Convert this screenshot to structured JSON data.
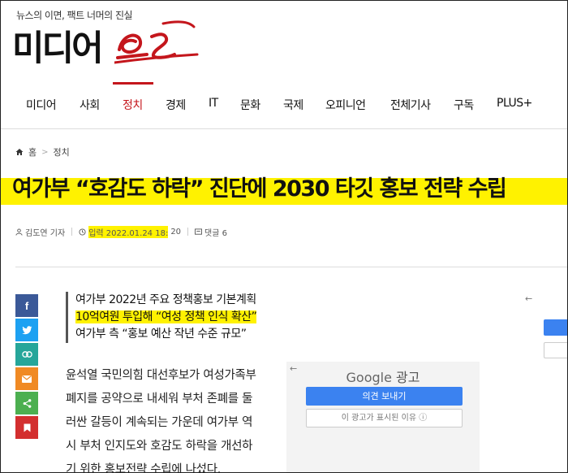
{
  "header": {
    "tagline": "뉴스의 이면, 팩트 너머의 진실",
    "logo_text": "미디어",
    "logo_script": "오늘"
  },
  "nav": {
    "items": [
      {
        "label": "미디어"
      },
      {
        "label": "사회"
      },
      {
        "label": "정치"
      },
      {
        "label": "경제"
      },
      {
        "label": "IT"
      },
      {
        "label": "문화"
      },
      {
        "label": "국제"
      },
      {
        "label": "오피니언"
      },
      {
        "label": "전체기사"
      },
      {
        "label": "구독"
      },
      {
        "label": "PLUS+"
      }
    ],
    "active": "정치",
    "accent_color": "#c4161c"
  },
  "breadcrumb": {
    "home": "홈",
    "section": "정치"
  },
  "article": {
    "headline": "여가부 “호감도 하락” 진단에 2030 타깃 홍보 전략 수립",
    "author": "김도연 기자",
    "date_label": "입력",
    "date": "2022.01.24 18:",
    "date_min": "20",
    "comments": "댓글 6",
    "subtitles": [
      "여가부 2022년 주요 정책홍보 기본계획",
      "10억여원 투입해 “여성 정책 인식 확산”",
      "여가부 측 “홍보 예산 작년 수준 규모”"
    ],
    "body_lines": [
      "윤석열 국민의힘 대선후보가 여성가족부",
      "폐지를 공약으로 내세워 부처 존폐를 둘",
      "러싼 갈등이 계속되는 가운데 여가부 역",
      "시 부처 인지도와 호감도 하락을 개선하",
      "기 위한 홍보전략 수립에 나섰다."
    ]
  },
  "share": [
    {
      "icon": "facebook-icon",
      "color": "#3b5998"
    },
    {
      "icon": "twitter-icon",
      "color": "#1da1f2"
    },
    {
      "icon": "link-icon",
      "color": "#26a69a"
    },
    {
      "icon": "mail-icon",
      "color": "#f08a24"
    },
    {
      "icon": "share-icon",
      "color": "#4caf50"
    },
    {
      "icon": "bookmark-icon",
      "color": "#d32f2f"
    }
  ],
  "ad": {
    "brand": "Google",
    "label": "광고",
    "button_primary": "의견 보내기",
    "button_secondary": "이 광고가 표시된 이유",
    "info_glyph": "ⓘ"
  },
  "highlight_color": "#fff200"
}
